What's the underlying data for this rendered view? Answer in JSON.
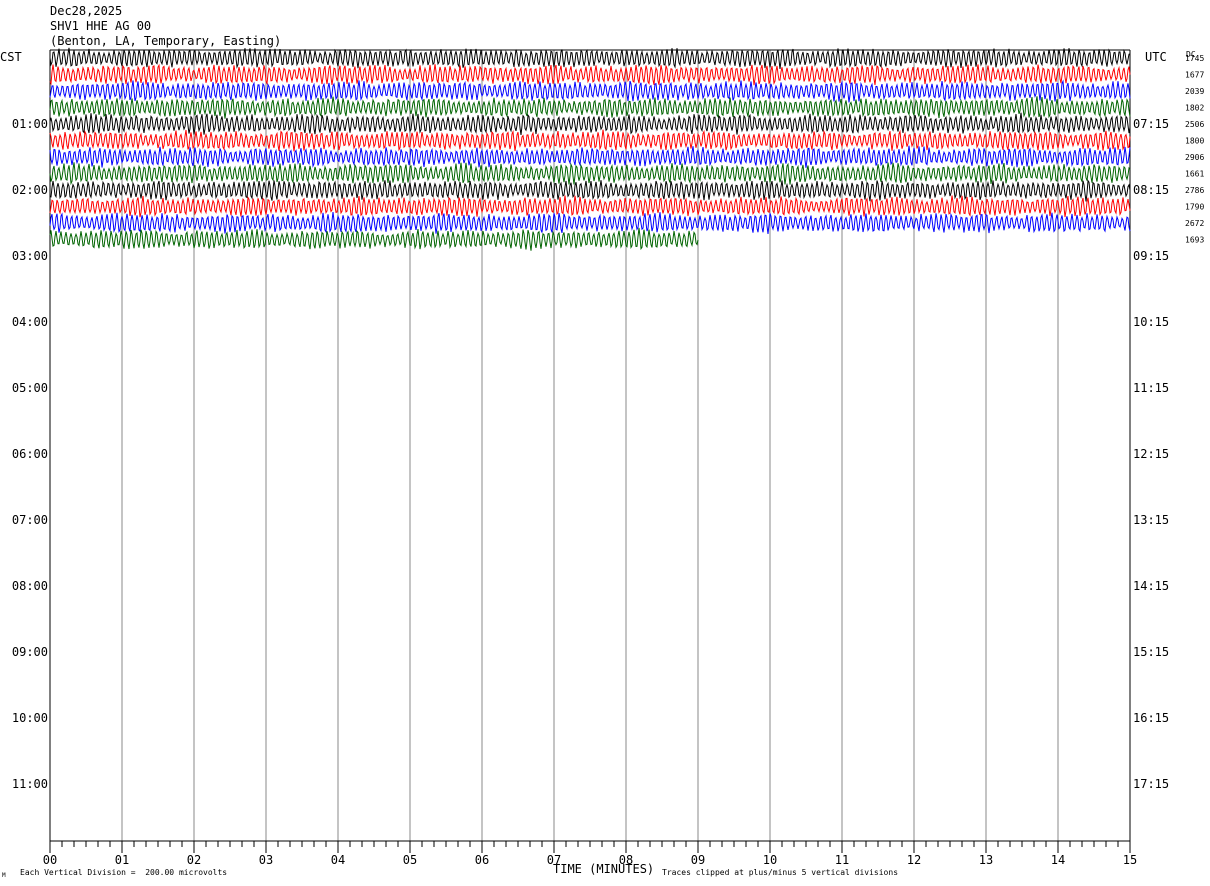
{
  "header": {
    "date": "Dec28,2025",
    "station": "SHV1 HHE AG 00",
    "location": "(Benton, LA, Temporary, Easting)"
  },
  "axes": {
    "left_label": "CST",
    "right_label": "UTC",
    "dc_label": "DC",
    "xlabel": "TIME (MINUTES)",
    "scale_note": "Each Vertical Division =  200.00 microvolts",
    "clip_note": "Traces clipped at plus/minus 5 vertical divisions",
    "corner_mark": "M"
  },
  "chart_data": {
    "type": "line",
    "title": "SHV1 HHE AG 00",
    "xlabel": "TIME (MINUTES)",
    "xlim": [
      0,
      15
    ],
    "x_ticks": [
      "00",
      "01",
      "02",
      "03",
      "04",
      "05",
      "06",
      "07",
      "08",
      "09",
      "10",
      "11",
      "12",
      "13",
      "14",
      "15"
    ],
    "hour_labels_left": [
      "01:00",
      "02:00",
      "03:00",
      "04:00",
      "05:00",
      "06:00",
      "07:00",
      "08:00",
      "09:00",
      "10:00",
      "11:00"
    ],
    "hour_labels_right": [
      "07:15",
      "08:15",
      "09:15",
      "10:15",
      "11:15",
      "12:15",
      "13:15",
      "14:15",
      "15:15",
      "16:15",
      "17:15"
    ],
    "rows_per_hour": 4,
    "trace_colors": [
      "#000000",
      "#ff0000",
      "#0000ff",
      "#006400"
    ],
    "dc_offsets": [
      "1745",
      "1677",
      "2039",
      "1802",
      "2506",
      "1800",
      "2906",
      "1661",
      "2786",
      "1790",
      "2672",
      "1693"
    ],
    "traces": [
      {
        "row": 0,
        "color": "#000000",
        "duration_minutes": 15
      },
      {
        "row": 1,
        "color": "#ff0000",
        "duration_minutes": 15
      },
      {
        "row": 2,
        "color": "#0000ff",
        "duration_minutes": 15
      },
      {
        "row": 3,
        "color": "#006400",
        "duration_minutes": 15
      },
      {
        "row": 4,
        "color": "#000000",
        "duration_minutes": 15
      },
      {
        "row": 5,
        "color": "#ff0000",
        "duration_minutes": 15
      },
      {
        "row": 6,
        "color": "#0000ff",
        "duration_minutes": 15
      },
      {
        "row": 7,
        "color": "#006400",
        "duration_minutes": 15
      },
      {
        "row": 8,
        "color": "#000000",
        "duration_minutes": 15
      },
      {
        "row": 9,
        "color": "#ff0000",
        "duration_minutes": 15
      },
      {
        "row": 10,
        "color": "#0000ff",
        "duration_minutes": 15
      },
      {
        "row": 11,
        "color": "#006400",
        "duration_minutes": 9
      }
    ]
  }
}
